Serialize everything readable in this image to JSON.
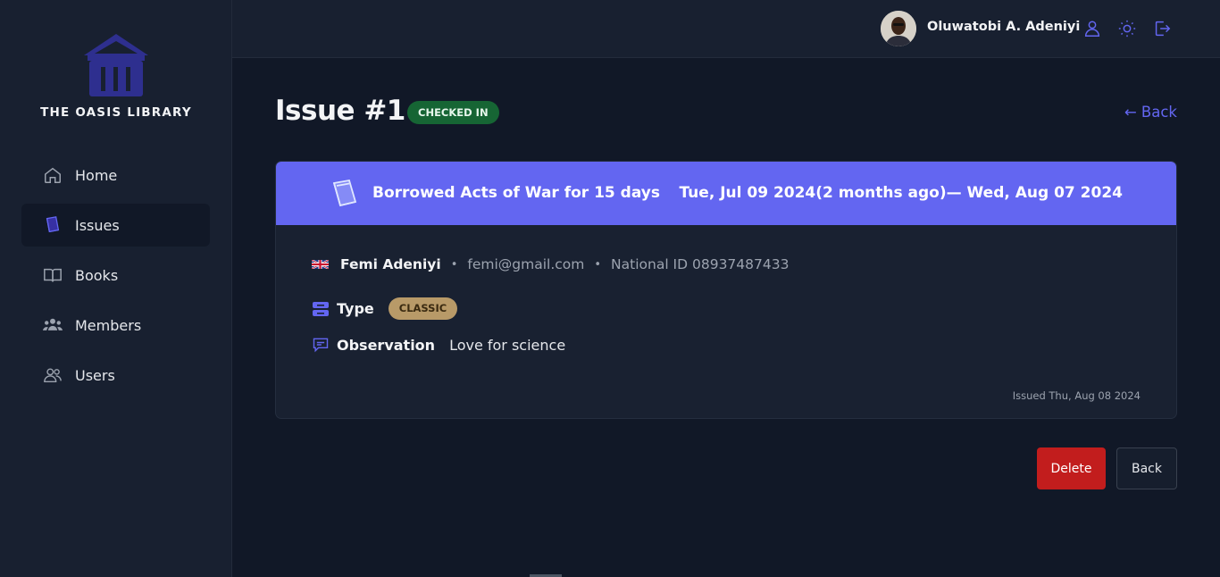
{
  "sidebar": {
    "logo_text": "THE OASIS LIBRARY",
    "items": [
      {
        "label": "Home",
        "icon": "home-icon"
      },
      {
        "label": "Issues",
        "icon": "issues-book-icon",
        "active": true
      },
      {
        "label": "Books",
        "icon": "open-book-icon"
      },
      {
        "label": "Members",
        "icon": "members-icon"
      },
      {
        "label": "Users",
        "icon": "users-icon"
      }
    ]
  },
  "header": {
    "user_name": "Oluwatobi A. Adeniyi",
    "icons": [
      "profile-icon",
      "sun-icon",
      "logout-icon"
    ]
  },
  "page": {
    "title": "Issue #1",
    "status": "CHECKED IN",
    "back_link": "← Back"
  },
  "issue": {
    "borrowed_text": "Borrowed Acts of War for 15 days",
    "dates_text": "Tue, Jul 09 2024(2 months ago)— Wed, Aug 07 2024",
    "member_name": "Femi Adeniyi",
    "member_email": "femi@gmail.com",
    "national_id": "National ID 08937487433",
    "type_label": "Type",
    "type_value": "CLASSIC",
    "observation_label": "Observation",
    "observation_value": "Love for science",
    "issued_text": "Issued Thu, Aug 08 2024"
  },
  "actions": {
    "delete_label": "Delete",
    "back_label": "Back"
  },
  "colors": {
    "accent": "#6366f1",
    "status_green": "#166534",
    "type_badge": "#b89a68",
    "delete_red": "#c21d1d"
  }
}
